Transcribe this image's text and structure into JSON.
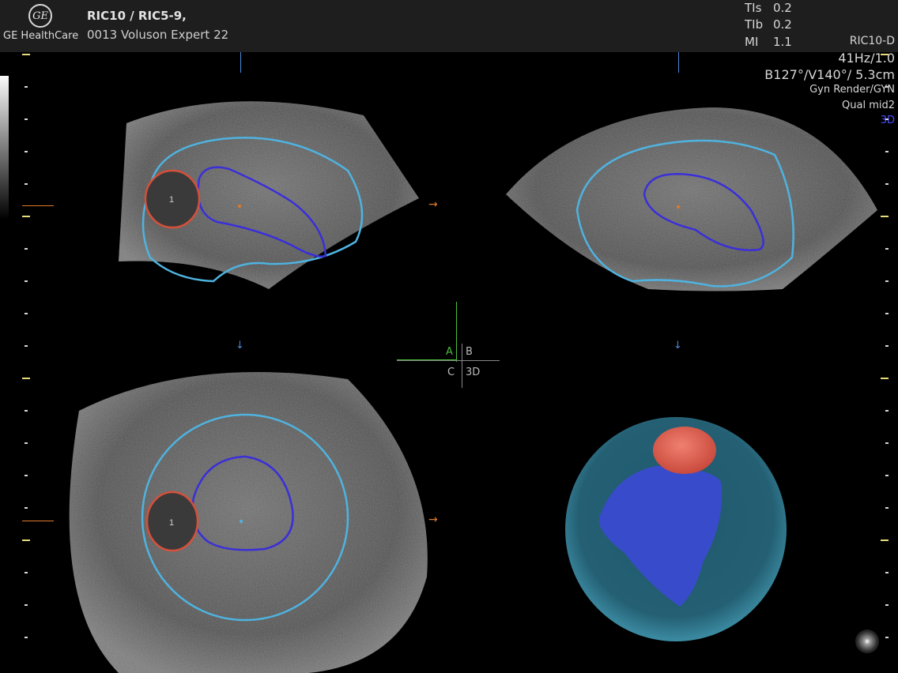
{
  "header": {
    "logo_text": "GE",
    "brand": "GE HealthCare",
    "probe": "RIC10 / RIC5-9,",
    "device": "0013 Voluson Expert 22",
    "indices": [
      {
        "label": "TIs",
        "value": "0.2"
      },
      {
        "label": "TIb",
        "value": "0.2"
      },
      {
        "label": "MI",
        "value": "1.1"
      }
    ]
  },
  "params": {
    "mode": "RIC10-D",
    "frame_rate": "41Hz/1.0",
    "angles": "B127°/V140°/ 5.3cm",
    "render": "Gyn Render/GYN",
    "quality": "Qual mid2",
    "mode3d": "3D"
  },
  "quadrant": {
    "a": "A",
    "b": "B",
    "c": "C",
    "d": "3D"
  },
  "markers": {
    "lesion": "1"
  },
  "colors": {
    "outer_contour": "#4fb3e0",
    "inner_contour": "#3a2fd8",
    "lesion_contour": "#d6503a",
    "arrow": "#e07a2a",
    "quad_a": "#4bbd3a"
  }
}
